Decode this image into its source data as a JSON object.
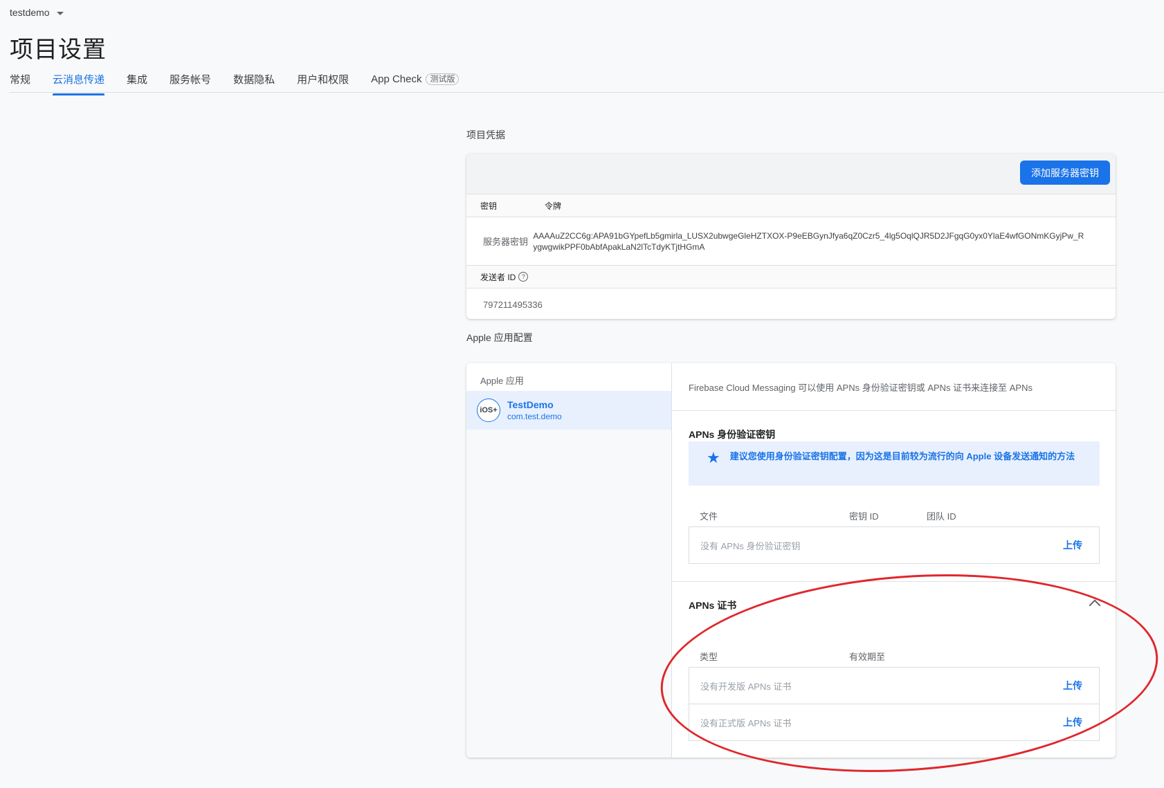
{
  "header": {
    "project_name": "testdemo",
    "page_title": "项目设置"
  },
  "tabs": [
    {
      "label": "常规"
    },
    {
      "label": "云消息传递"
    },
    {
      "label": "集成"
    },
    {
      "label": "服务帐号"
    },
    {
      "label": "数据隐私"
    },
    {
      "label": "用户和权限"
    },
    {
      "label": "App Check",
      "badge": "测试版"
    }
  ],
  "credentials": {
    "section_title": "项目凭据",
    "add_server_key_button": "添加服务器密钥",
    "col_key": "密钥",
    "col_token": "令牌",
    "server_key_label": "服务器密钥",
    "server_key_token": "AAAAuZ2CC6g:APA91bGYpefLb5gmirla_LUSX2ubwgeGleHZTXOX-P9eEBGynJfya6qZ0Czr5_4lg5OqlQJR5D2JFgqG0yx0YlaE4wfGONmKGyjPw_RygwgwikPPF0bAbfApakLaN2lTcTdyKTjtHGmA",
    "sender_id_label": "发送者 ID",
    "sender_id_value": "797211495336"
  },
  "apple": {
    "section_title": "Apple 应用配置",
    "list_header": "Apple 应用",
    "app": {
      "badge": "iOS+",
      "name": "TestDemo",
      "bundle": "com.test.demo"
    },
    "intro_text": "Firebase Cloud Messaging 可以使用 APNs 身份验证密钥或 APNs 证书来连接至 APNs",
    "auth_key": {
      "title": "APNs 身份验证密钥",
      "banner": "建议您使用身份验证密钥配置，因为这是目前较为流行的向 Apple 设备发送通知的方法",
      "col_file": "文件",
      "col_key_id": "密钥 ID",
      "col_team_id": "团队 ID",
      "empty_text": "没有 APNs 身份验证密钥",
      "upload": "上传"
    },
    "certs": {
      "title": "APNs 证书",
      "col_type": "类型",
      "col_expiry": "有效期至",
      "dev_empty": "没有开发版 APNs 证书",
      "prod_empty": "没有正式版 APNs 证书",
      "upload": "上传"
    }
  },
  "colors": {
    "accent": "#1a73e8",
    "annotation": "#e0262b"
  }
}
